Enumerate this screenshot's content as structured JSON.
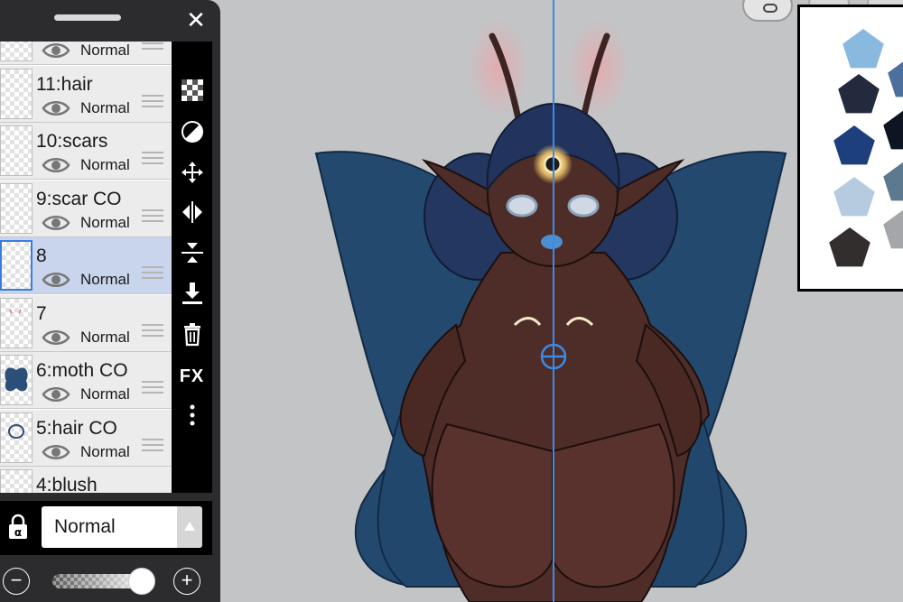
{
  "panel": {
    "close_label": "✕",
    "layers": [
      {
        "name": "",
        "blend": "Normal",
        "thumb": "blank",
        "selected": false
      },
      {
        "name": "11:hair",
        "blend": "Normal",
        "thumb": "blank",
        "selected": false
      },
      {
        "name": "10:scars",
        "blend": "Normal",
        "thumb": "blank",
        "selected": false
      },
      {
        "name": "9:scar CO",
        "blend": "Normal",
        "thumb": "blank",
        "selected": false
      },
      {
        "name": "8",
        "blend": "Normal",
        "thumb": "blank",
        "selected": true
      },
      {
        "name": "7",
        "blend": "Normal",
        "thumb": "marks",
        "selected": false
      },
      {
        "name": "6:moth CO",
        "blend": "Normal",
        "thumb": "moth",
        "selected": false
      },
      {
        "name": "5:hair CO",
        "blend": "Normal",
        "thumb": "hair",
        "selected": false
      },
      {
        "name": "4:blush",
        "blend": "Normal",
        "thumb": "blank",
        "selected": false
      }
    ],
    "toolbar": {
      "tools": [
        "checker-icon",
        "contrast-icon",
        "move-icon",
        "flip-horizontal-icon",
        "merge-down-icon",
        "download-icon",
        "trash-icon",
        "fx-icon",
        "more-icon"
      ],
      "fx_label": "FX"
    },
    "blend_mode": {
      "label": "Normal"
    },
    "opacity": {
      "value": 0.9,
      "minus_label": "−",
      "plus_label": "+"
    }
  },
  "palette": {
    "swatches": [
      "#8ab9e0",
      "#4d6f9e",
      "#232a3d",
      "#0d1422",
      "#1e3f7e",
      "#5d7990",
      "#b7cbe0",
      "#a5a6a9",
      "#332e2e"
    ]
  },
  "colors": {
    "panel_bg": "#2c2c2e",
    "selected_row": "#c9d5ec",
    "guide_line": "#3a8be8",
    "wing": "#24496f",
    "skin": "#4e2c27"
  }
}
